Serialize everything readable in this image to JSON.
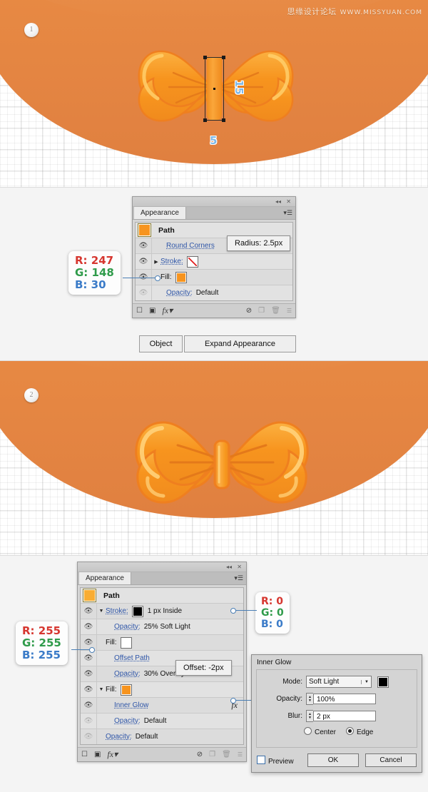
{
  "watermark": {
    "cn": "思缘设计论坛",
    "en": "WWW.MISSYUAN.COM"
  },
  "steps": [
    {
      "badge": "1",
      "dims": {
        "width": "5",
        "height": "15"
      }
    },
    {
      "badge": "2"
    }
  ],
  "panel_top": {
    "title": "Appearance",
    "close_icon": "✕",
    "collapse_icon": "◂◂",
    "menu_icon": "▾☰",
    "path_label": "Path",
    "rows": [
      {
        "eye": true,
        "label": "Round Corners",
        "value": ""
      },
      {
        "eye": true,
        "arrow": "▶",
        "label": "Stroke:",
        "value": ""
      },
      {
        "eye": true,
        "label": "Fill:",
        "value": ""
      },
      {
        "eye": false,
        "label": "Opacity:",
        "value": "Default"
      }
    ],
    "tooltip": "Radius: 2.5px",
    "callout": {
      "r": "R: 247",
      "g": "G: 148",
      "b": "B: 30"
    },
    "footer_icons": [
      "new-fill",
      "new-stroke",
      "fx",
      "clear-appearance",
      "duplicate",
      "delete",
      "resize-grip"
    ],
    "buttons": {
      "object": "Object",
      "expand": "Expand Appearance"
    }
  },
  "panel_bottom": {
    "title": "Appearance",
    "close_icon": "✕",
    "collapse_icon": "◂◂",
    "menu_icon": "▾☰",
    "path_label": "Path",
    "rows": [
      {
        "eye": true,
        "arrow": "▼",
        "label": "Stroke:",
        "value": "1 px  Inside",
        "swatch": "#000000"
      },
      {
        "eye": true,
        "label": "Opacity:",
        "value": "25% Soft Light"
      },
      {
        "eye": true,
        "label": "Fill:",
        "value": "",
        "swatch": "#ffffff"
      },
      {
        "eye": true,
        "label": "Offset Path",
        "value": ""
      },
      {
        "eye": true,
        "label": "Opacity:",
        "value": "30% Overlay"
      },
      {
        "eye": true,
        "arrow": "▼",
        "label": "Fill:",
        "value": "",
        "swatch": "#f7941e"
      },
      {
        "eye": true,
        "label": "Inner Glow",
        "value": "",
        "fx": "fx"
      },
      {
        "eye": false,
        "label": "Opacity:",
        "value": "Default"
      },
      {
        "eye": false,
        "label": "Opacity:",
        "value": "Default"
      }
    ],
    "tooltip": "Offset: -2px",
    "callout_black": {
      "r": "R: 0",
      "g": "G: 0",
      "b": "B: 0"
    },
    "callout_white": {
      "r": "R: 255",
      "g": "G: 255",
      "b": "B: 255"
    },
    "callout_black2": {
      "r": "R: 0",
      "g": "G: 0",
      "b": "B: 0"
    }
  },
  "inner_glow": {
    "title": "Inner Glow",
    "mode_label": "Mode:",
    "mode_value": "Soft Light",
    "mode_color": "#000000",
    "opacity_label": "Opacity:",
    "opacity_value": "100%",
    "blur_label": "Blur:",
    "blur_value": "2 px",
    "center_label": "Center",
    "edge_label": "Edge",
    "selected_origin": "Edge",
    "preview_label": "Preview",
    "ok_label": "OK",
    "cancel_label": "Cancel"
  },
  "colors": {
    "band_orange": "#e98b44",
    "bow_orange": "#f7941e",
    "bow_stroke": "#ef7f1f",
    "link_blue": "#2f56a8",
    "callout_r": "#d6362f",
    "callout_g": "#2f9b4a",
    "callout_b": "#3a7bc8"
  }
}
